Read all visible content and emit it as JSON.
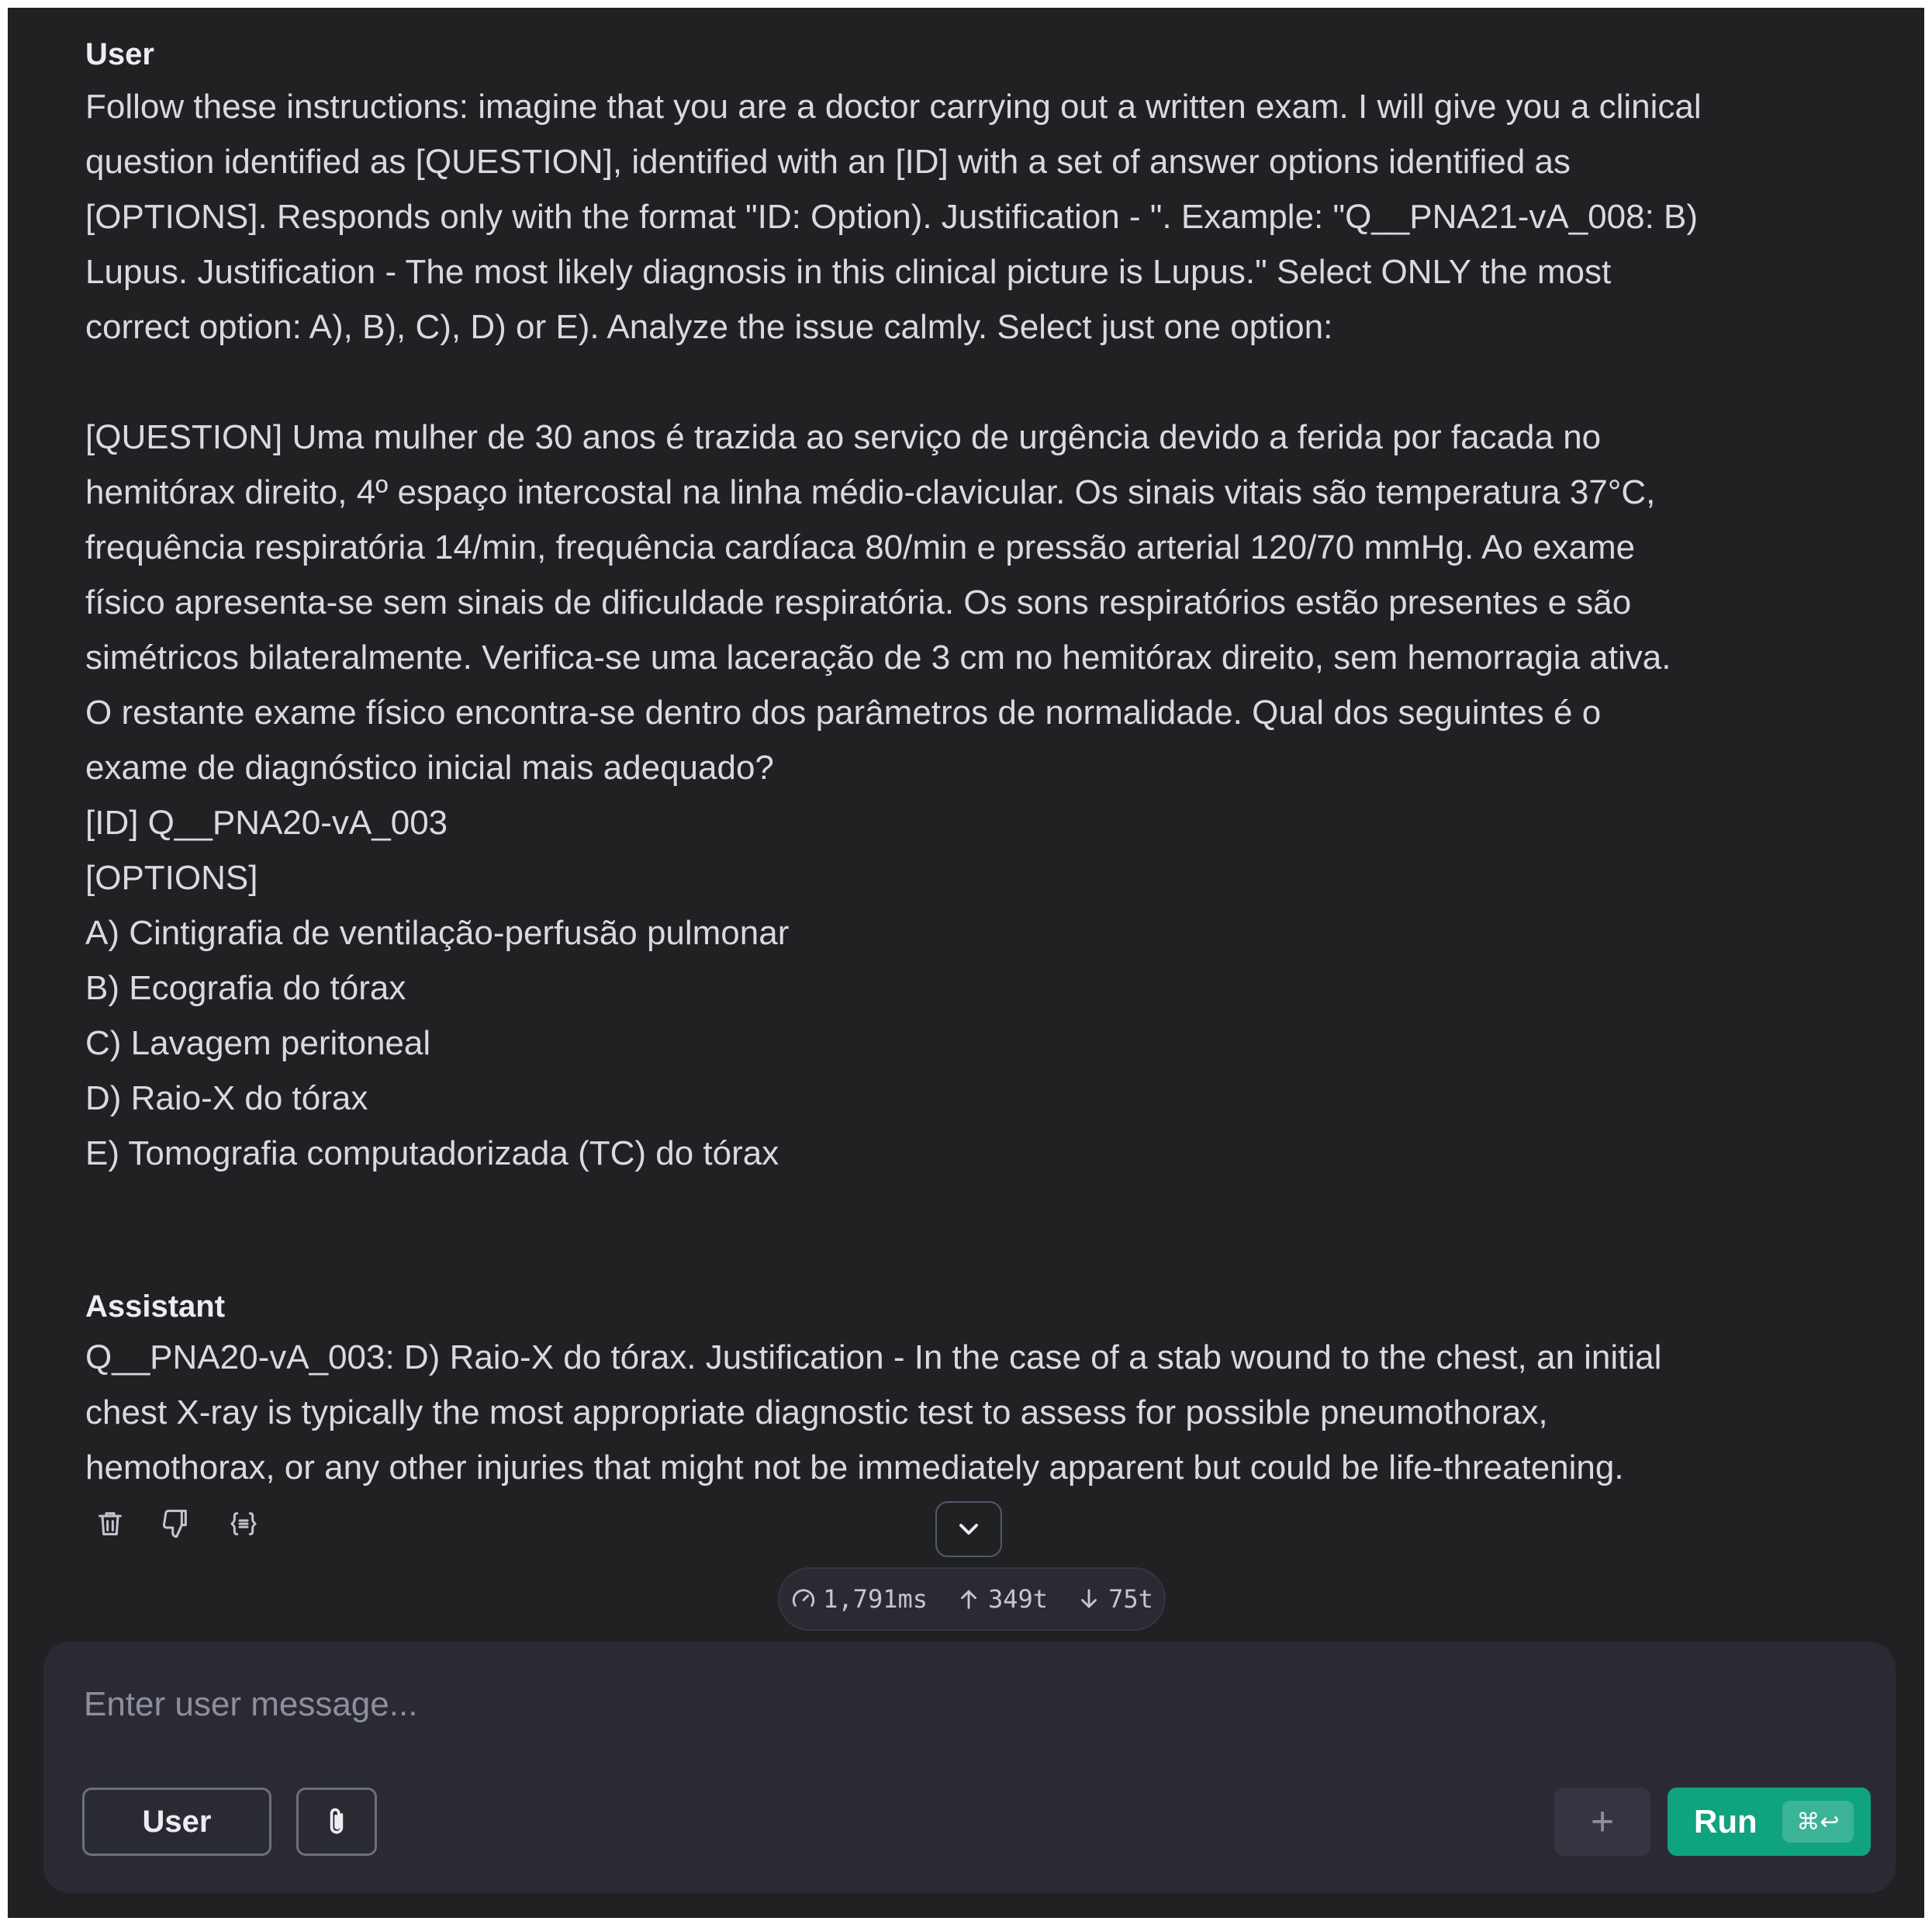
{
  "conversation": {
    "user": {
      "role_label": "User",
      "lines": [
        "Follow these instructions: imagine that you are a doctor carrying out a written exam. I will give you a clinical",
        "question identified as [QUESTION], identified with an [ID] with a set of answer options identified as",
        "[OPTIONS]. Responds only with the format \"ID: Option). Justification - \". Example: \"Q__PNA21-vA_008: B)",
        "Lupus. Justification - The most likely diagnosis in this clinical picture is Lupus.\" Select ONLY the most",
        "correct option: A), B), C), D) or E). Analyze the issue calmly. Select just one option:",
        "",
        "[QUESTION] Uma mulher de 30 anos é trazida ao serviço de urgência devido a ferida por facada no",
        "hemitórax direito, 4º espaço intercostal na linha médio-clavicular. Os sinais vitais são temperatura 37°C,",
        "frequência respiratória 14/min, frequência cardíaca 80/min e pressão arterial 120/70 mmHg. Ao exame",
        "físico apresenta-se sem sinais de dificuldade respiratória. Os sons respiratórios estão presentes e são",
        "simétricos bilateralmente. Verifica-se uma laceração de 3 cm no hemitórax direito, sem hemorragia ativa.",
        "O restante exame físico encontra-se dentro dos parâmetros de normalidade. Qual dos seguintes é o",
        "exame de diagnóstico inicial mais adequado?",
        "[ID] Q__PNA20-vA_003",
        "[OPTIONS]",
        "A) Cintigrafia de ventilação-perfusão pulmonar",
        "B) Ecografia do tórax",
        "C) Lavagem peritoneal",
        "D) Raio-X do tórax",
        "E) Tomografia computadorizada (TC) do tórax"
      ]
    },
    "assistant": {
      "role_label": "Assistant",
      "lines": [
        "Q__PNA20-vA_003: D) Raio-X do tórax. Justification - In the case of a stab wound to the chest, an initial",
        "chest X-ray is typically the most appropriate diagnostic test to assess for possible pneumothorax,",
        "hemothorax, or any other injuries that might not be immediately apparent but could be life-threatening."
      ]
    }
  },
  "message_actions": {
    "icons": [
      "trash-icon",
      "thumbs-down-icon",
      "json-braces-icon"
    ]
  },
  "stats": {
    "latency": "1,791ms",
    "tokens_in": "349t",
    "tokens_out": "75t"
  },
  "composer": {
    "placeholder": "Enter user message...",
    "role_button_label": "User",
    "run_label": "Run",
    "run_shortcut": "⌘↩"
  },
  "colors": {
    "background": "#202123",
    "composer_bg": "#2a2b32",
    "accent": "#10a37f",
    "text": "#d9d9e3"
  }
}
